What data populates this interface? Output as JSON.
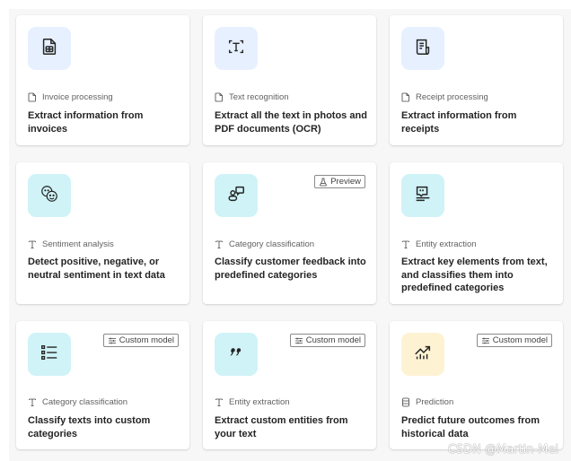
{
  "colors": {
    "tile_blue": "#e6f0ff",
    "tile_cyan": "#cff3f7",
    "tile_yellow": "#fdf3d3"
  },
  "cards": [
    {
      "icon": "invoice-icon",
      "tile": "blue",
      "category_icon": "document-icon",
      "category": "Invoice processing",
      "title": "Extract information from invoices",
      "badge": null
    },
    {
      "icon": "text-recognition-icon",
      "tile": "blue",
      "category_icon": "document-icon",
      "category": "Text recognition",
      "title": "Extract all the text in photos and PDF documents (OCR)",
      "badge": null
    },
    {
      "icon": "receipt-icon",
      "tile": "blue",
      "category_icon": "document-icon",
      "category": "Receipt processing",
      "title": "Extract information from receipts",
      "badge": null
    },
    {
      "icon": "sentiment-icon",
      "tile": "cyan",
      "category_icon": "text-icon",
      "category": "Sentiment analysis",
      "title": "Detect positive, negative, or neutral sentiment in text data",
      "badge": null
    },
    {
      "icon": "feedback-icon",
      "tile": "cyan",
      "category_icon": "text-icon",
      "category": "Category classification",
      "title": "Classify customer feedback into predefined categories",
      "badge": {
        "icon": "flask-icon",
        "label": "Preview"
      }
    },
    {
      "icon": "entity-icon",
      "tile": "cyan",
      "category_icon": "text-icon",
      "category": "Entity extraction",
      "title": "Extract key elements from text, and classifies them into predefined categories",
      "badge": null
    },
    {
      "icon": "list-icon",
      "tile": "cyan",
      "category_icon": "text-icon",
      "category": "Category classification",
      "title": "Classify texts into custom categories",
      "badge": {
        "icon": "sliders-icon",
        "label": "Custom model"
      }
    },
    {
      "icon": "quote-icon",
      "tile": "cyan",
      "category_icon": "text-icon",
      "category": "Entity extraction",
      "title": "Extract custom entities from your text",
      "badge": {
        "icon": "sliders-icon",
        "label": "Custom model"
      }
    },
    {
      "icon": "trend-chart-icon",
      "tile": "yellow",
      "category_icon": "database-icon",
      "category": "Prediction",
      "title": "Predict future outcomes from historical data",
      "badge": {
        "icon": "sliders-icon",
        "label": "Custom model"
      }
    }
  ],
  "watermark": "CSDN @Martin-Mei"
}
